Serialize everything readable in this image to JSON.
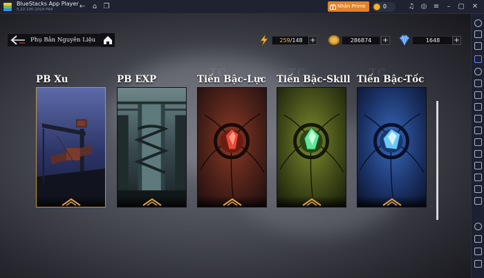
{
  "window": {
    "app_name": "BlueStacks App Player",
    "version": "5.22.100.1019  P64",
    "prime_label": "Nhận Prime >",
    "coin_count": "0"
  },
  "header": {
    "back_title": "Phụ Bản Nguyên Liệu"
  },
  "resources": {
    "energy": {
      "current": "259",
      "max": "/148",
      "icon": "lightning-icon"
    },
    "gold": {
      "value": "286874",
      "icon": "gold-coin-icon"
    },
    "diamond": {
      "value": "1648",
      "icon": "diamond-icon"
    }
  },
  "cards": [
    {
      "title": "PB Xu"
    },
    {
      "title": "PB EXP"
    },
    {
      "title": "Tiến Bậc-Lực",
      "ghost": "TC"
    },
    {
      "title": "Tiến Bậc-Skill",
      "ghost": "TC"
    },
    {
      "title": "Tiến Bậc-Tốc",
      "ghost": "TC"
    }
  ],
  "colors": {
    "accent_orange": "#e0822b",
    "card_red": "#5a2a1e",
    "card_green": "#4f5a1d",
    "card_blue": "#203a6c"
  }
}
